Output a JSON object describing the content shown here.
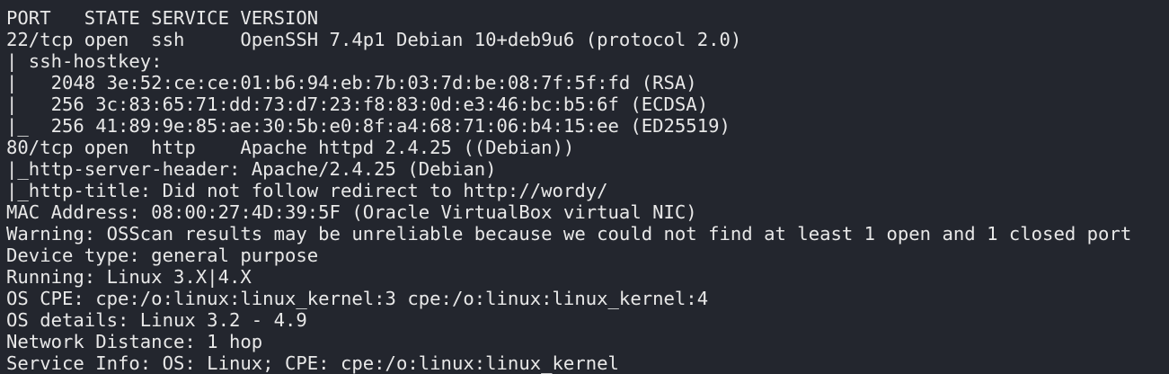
{
  "terminal": {
    "colors": {
      "background": "#23262e",
      "foreground": "#e8e8e8"
    },
    "lines": [
      "PORT   STATE SERVICE VERSION",
      "22/tcp open  ssh     OpenSSH 7.4p1 Debian 10+deb9u6 (protocol 2.0)",
      "| ssh-hostkey: ",
      "|   2048 3e:52:ce:ce:01:b6:94:eb:7b:03:7d:be:08:7f:5f:fd (RSA)",
      "|   256 3c:83:65:71:dd:73:d7:23:f8:83:0d:e3:46:bc:b5:6f (ECDSA)",
      "|_  256 41:89:9e:85:ae:30:5b:e0:8f:a4:68:71:06:b4:15:ee (ED25519)",
      "80/tcp open  http    Apache httpd 2.4.25 ((Debian))",
      "|_http-server-header: Apache/2.4.25 (Debian)",
      "|_http-title: Did not follow redirect to http://wordy/",
      "MAC Address: 08:00:27:4D:39:5F (Oracle VirtualBox virtual NIC)",
      "Warning: OSScan results may be unreliable because we could not find at least 1 open and 1 closed port",
      "Device type: general purpose",
      "Running: Linux 3.X|4.X",
      "OS CPE: cpe:/o:linux:linux_kernel:3 cpe:/o:linux:linux_kernel:4",
      "OS details: Linux 3.2 - 4.9",
      "Network Distance: 1 hop",
      "Service Info: OS: Linux; CPE: cpe:/o:linux:linux_kernel"
    ]
  }
}
